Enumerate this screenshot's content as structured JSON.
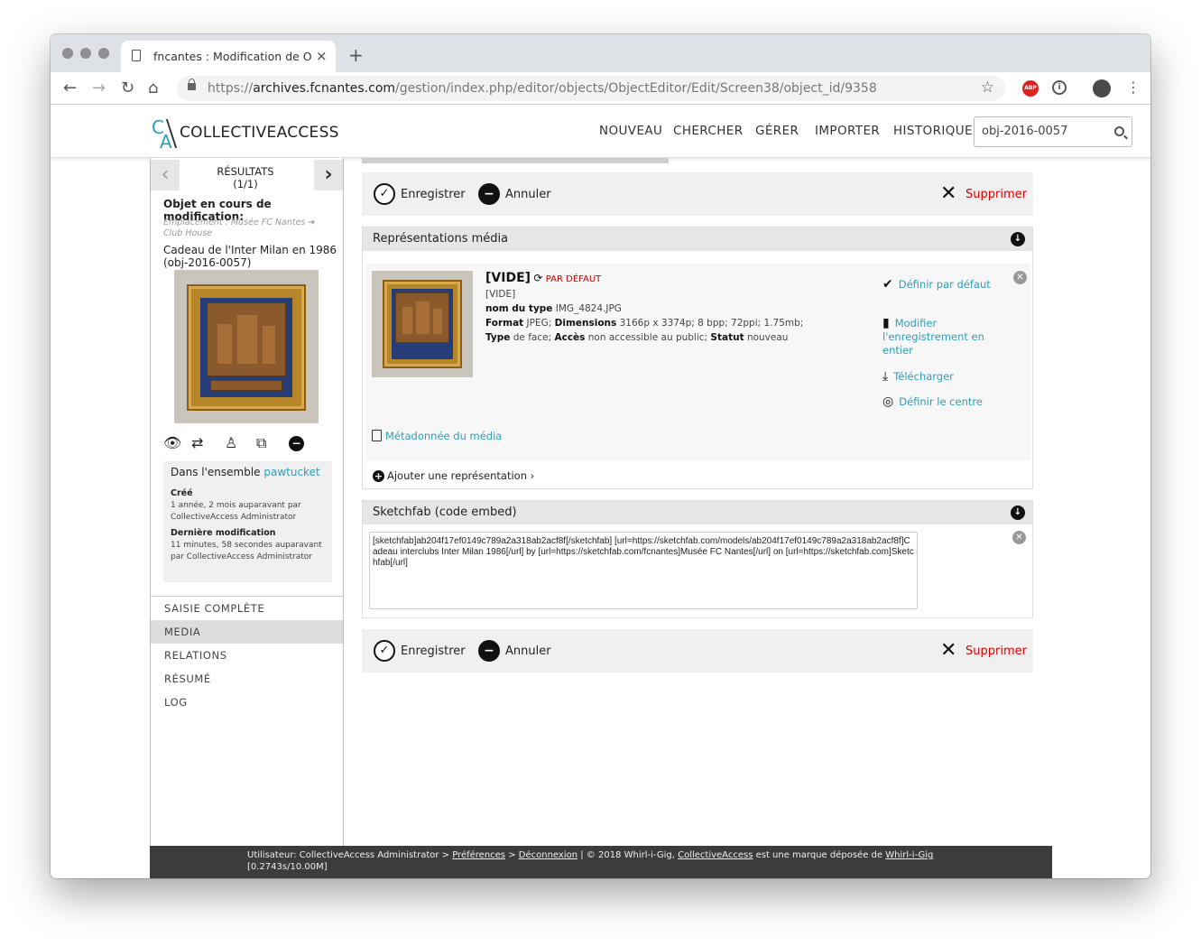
{
  "browser": {
    "tab_title": "fncantes : Modification de Objet",
    "tab_close": "×",
    "new_tab": "+",
    "url_scheme": "https://",
    "url_host": "archives.fcnantes.com",
    "url_path": "/gestion/index.php/editor/objects/ObjectEditor/Edit/Screen38/object_id/9358",
    "ext_abp": "ABP"
  },
  "site": {
    "logo_c": "C",
    "logo_a": "A",
    "logo_name": "COLLECTIVEACCESS",
    "nav": [
      "NOUVEAU",
      "CHERCHER",
      "GÉRER",
      "IMPORTER",
      "HISTORIQUE"
    ],
    "search_value": "obj-2016-0057"
  },
  "sidebar": {
    "results_label": "RÉSULTATS",
    "results_count": "(1/1)",
    "editing_label": "Objet en cours de modification:",
    "location": "Emplacement : Musée FC Nantes ➜ Club House",
    "object_title": "Cadeau de l'Inter Milan en 1986 (obj-2016-0057)",
    "set_prefix": "Dans l'ensemble ",
    "set_name": "pawtucket",
    "created_label": "Créé",
    "created_value": "1 année, 2 mois auparavant par CollectiveAccess Administrator",
    "modified_label": "Dernière modification",
    "modified_value": "11 minutes, 58 secondes auparavant par CollectiveAccess Administrator",
    "menu": [
      "SAISIE COMPLÈTE",
      "MEDIA",
      "RELATIONS",
      "RÉSUMÉ",
      "LOG"
    ],
    "active_menu": "MEDIA"
  },
  "actions": {
    "save": "Enregistrer",
    "cancel": "Annuler",
    "delete": "Supprimer"
  },
  "media_bundle": {
    "title": "Représentations média",
    "vide": "[VIDE]",
    "par_defaut": "PAR DÉFAUT",
    "vide_small": "[VIDE]",
    "type_label": "nom du type",
    "type_value": "IMG_4824.JPG",
    "format_label": "Format",
    "format_value": "JPEG;",
    "dimensions_label": "Dimensions",
    "dimensions_value": "3166p x 3374p; 8 bpp; 72ppi; 1.75mb;",
    "typ_label": "Type",
    "typ_value": "de face;",
    "access_label": "Accès",
    "access_value": "non accessible au public;",
    "status_label": "Statut",
    "status_value": "nouveau",
    "act_default": "Définir par défaut",
    "act_edit": "Modifier l'enregistrement en entier",
    "act_download": "Télécharger",
    "act_center": "Définir le centre",
    "metadata_link": "Métadonnée du média",
    "add_rep": "Ajouter une représentation ›"
  },
  "sketchfab_bundle": {
    "title": "Sketchfab (code embed)",
    "embed": "[sketchfab]ab204f17ef0149c789a2a318ab2acf8f[/sketchfab] [url=https://sketchfab.com/models/ab204f17ef0149c789a2a318ab2acf8f]Cadeau interclubs Inter Milan 1986[/url] by [url=https://sketchfab.com/fcnantes]Musée FC Nantes[/url] on [url=https://sketchfab.com]Sketchfab[/url]"
  },
  "footer": {
    "user_prefix": "Utilisateur: CollectiveAccess Administrator > ",
    "prefs": "Préférences",
    "sep": " > ",
    "logout": "Déconnexion",
    "copyright_prefix": "  |  © 2018 Whirl-i-Gig, ",
    "ca_link": "CollectiveAccess",
    "trademark": " est une marque déposée de ",
    "wig_link": "Whirl-i-Gig",
    "timing": "[0.2743s/10.00M]"
  },
  "colors": {
    "accent": "#2a9fbe",
    "delete": "#dd0000",
    "footer_bg": "#3c3c3c"
  },
  "icons": {
    "back": "arrow-left-icon",
    "forward": "arrow-right-icon",
    "reload": "reload-icon",
    "home": "home-icon",
    "bookmark": "star-icon",
    "search": "search-icon",
    "view": "eye-icon",
    "duplicate": "duplicate-icon",
    "person": "person-icon",
    "copy": "copy-icon",
    "delete": "delete-circle-icon",
    "save": "check-circle-icon",
    "cancel": "minus-circle-icon",
    "remove": "x-icon",
    "toggle": "chevron-down-circle-icon"
  }
}
